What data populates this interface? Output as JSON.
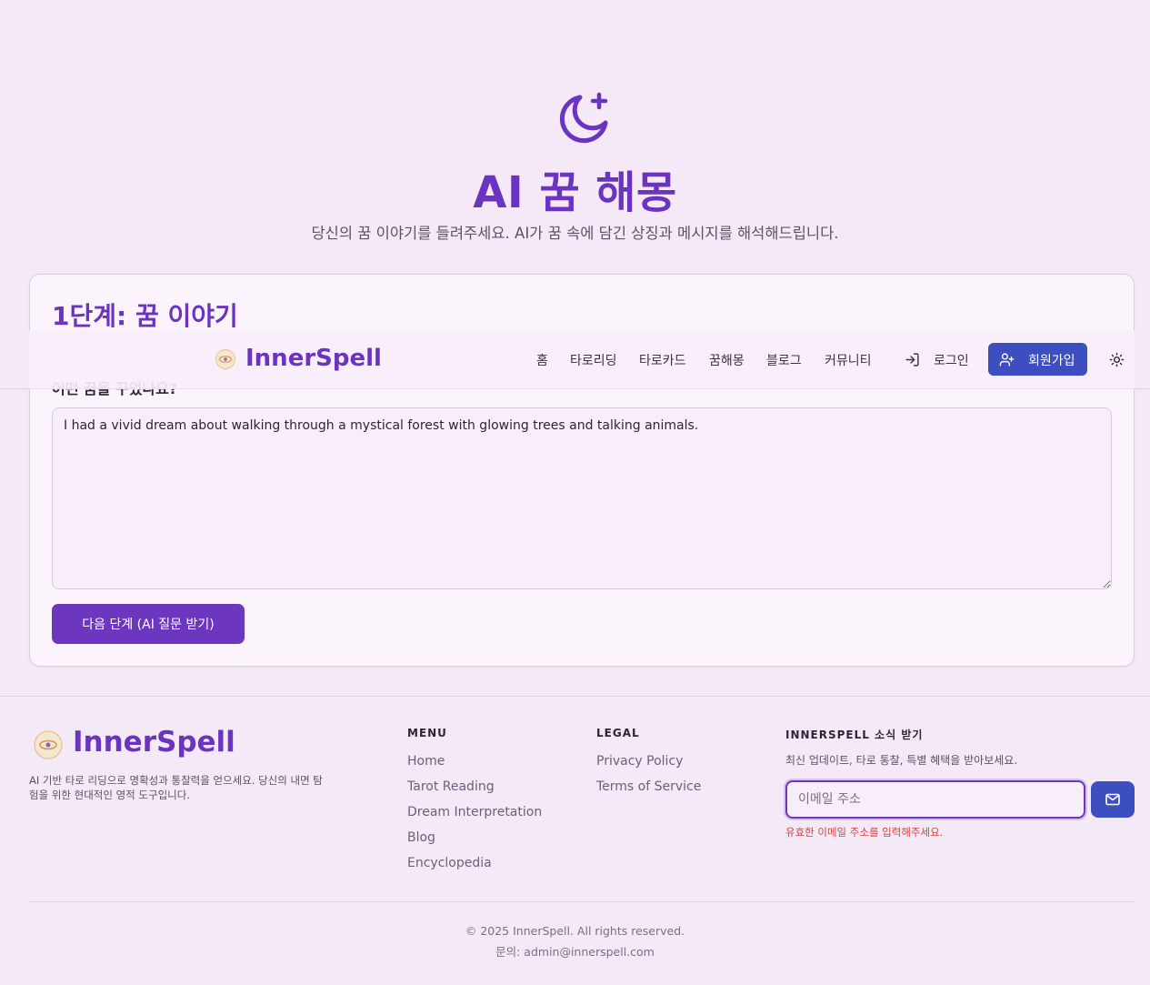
{
  "hero": {
    "icon": "moon-star-icon",
    "title": "AI 꿈 해몽",
    "subtitle": "당신의 꿈 이야기를 들려주세요. AI가 꿈 속에 담긴 상징과 메시지를 해석해드립니다."
  },
  "card": {
    "step_title": "1단계: 꿈 이야기",
    "step_description": "",
    "field_label": "어떤 꿈을 꾸었나요?",
    "dream_text": "I had a vivid dream about walking through a mystical forest with glowing trees and talking animals.",
    "next_button": "다음 단계 (AI 질문 받기)"
  },
  "nav": {
    "brand": "InnerSpell",
    "links": [
      "홈",
      "타로리딩",
      "타로카드",
      "꿈해몽",
      "블로그",
      "커뮤니티"
    ],
    "login": "로그인",
    "signup": "회원가입",
    "theme_icon": "sun-icon"
  },
  "footer": {
    "brand": "InnerSpell",
    "tagline": "AI 기반 타로 리딩으로 명확성과 통찰력을 얻으세요. 당신의 내면 탐험을 위한 현대적인 영적 도구입니다.",
    "menu": {
      "heading": "MENU",
      "links": [
        "Home",
        "Tarot Reading",
        "Dream Interpretation",
        "Blog",
        "Encyclopedia"
      ]
    },
    "legal": {
      "heading": "LEGAL",
      "links": [
        "Privacy Policy",
        "Terms of Service"
      ]
    },
    "newsletter": {
      "heading": "INNERSPELL 소식 받기",
      "description": "최신 업데이트, 타로 통찰, 특별 혜택을 받아보세요.",
      "placeholder": "이메일 주소",
      "error": "유효한 이메일 주소를 입력해주세요."
    },
    "copyright": "© 2025 InnerSpell. All rights reserved.",
    "contact": "문의: admin@innerspell.com"
  },
  "colors": {
    "brand_purple": "#6b34c0",
    "primary_button": "#6d36bf",
    "signup_blue": "#3d4fc0",
    "error_red": "#d9443a",
    "background": "#f5e9f7"
  }
}
